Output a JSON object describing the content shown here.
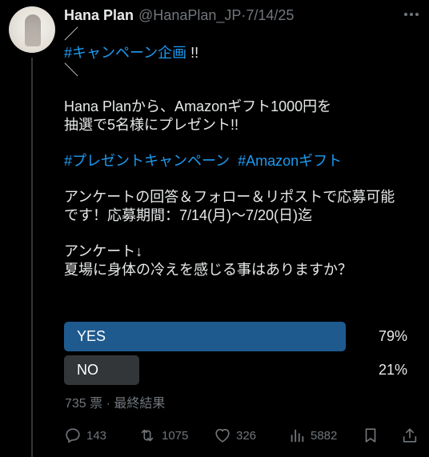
{
  "post": {
    "author": {
      "name": "Hana Plan",
      "handle": "@HanaPlan_JP",
      "separator": "·",
      "date": "7/14/25"
    },
    "text": {
      "line1": "／",
      "hashtag1": "#キャンペーン企画",
      "line2_suffix": " !!",
      "line3": "＼",
      "line5": "Hana Planから、Amazonギフト1000円を",
      "line6": "抽選で5名様にプレゼント!!",
      "hashtag2": "#プレゼントキャンペーン",
      "hashtag_gap": "  ",
      "hashtag3": "#Amazonギフト",
      "line10": "アンケートの回答＆フォロー＆リポストで応募可能",
      "line11": "です！応募期間：7/14(月)〜7/20(日)迄",
      "line13": "アンケート↓",
      "line14": "夏場に身体の冷えを感じる事はありますか？"
    },
    "poll": {
      "options": [
        {
          "label": "YES",
          "percent_text": "79%",
          "fraction": 0.79,
          "bar_color": "#1e5a8e"
        },
        {
          "label": "NO",
          "percent_text": "21%",
          "fraction": 0.21,
          "bar_color": "#333639"
        }
      ],
      "votes": "735 票",
      "separator": "·",
      "status": "最終結果"
    },
    "actions": {
      "replies": "143",
      "reposts": "1075",
      "likes": "326",
      "views": "5882"
    }
  },
  "colors": {
    "background": "#000000",
    "text": "#e7e9ea",
    "muted": "#71767b",
    "link": "#1d9bf0",
    "winner_bar": "#1e5a8e",
    "loser_bar": "#333639"
  },
  "icons": [
    "more-icon",
    "reply-icon",
    "repost-icon",
    "like-icon",
    "views-icon",
    "bookmark-icon",
    "share-icon"
  ]
}
